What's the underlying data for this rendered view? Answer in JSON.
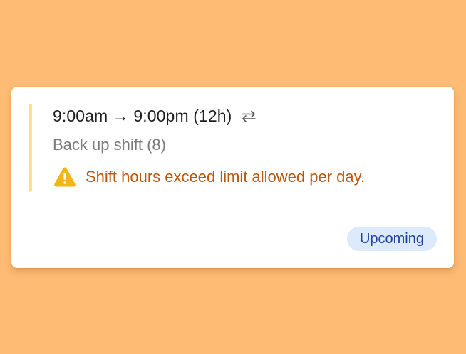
{
  "shift_card": {
    "time_range": "9:00am → 9:00pm (12h)",
    "repeat_icon": "repeat-icon",
    "shift_name": "Back up shift (8)",
    "warning_icon": "warning-triangle-icon",
    "warning_message": "Shift hours exceed limit allowed per day.",
    "status_badge": "Upcoming"
  },
  "colors": {
    "background": "#FDBB74",
    "card": "#FFFFFF",
    "accent_bar": "#FBE47F",
    "warning_text": "#B9570C",
    "warning_icon": "#F2B619",
    "badge_background": "#DCEAFB",
    "badge_text": "#1E3FA0"
  }
}
